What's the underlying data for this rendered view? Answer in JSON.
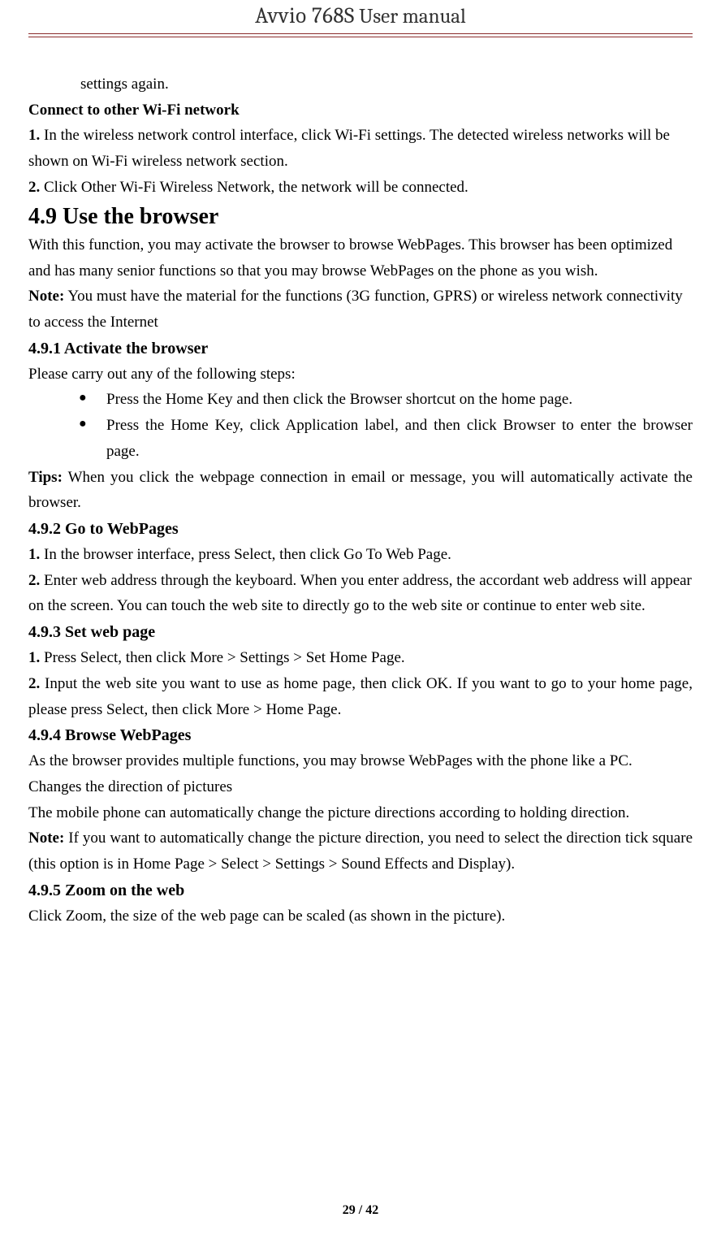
{
  "header": {
    "title_model": "Avvio 768S",
    "title_suffix": " User manual"
  },
  "body": {
    "p_settings_again": "settings again.",
    "h_connect_other": "Connect to other Wi-Fi network",
    "step_c1_a": "1.",
    "step_c1_b": " In the wireless network control interface, click Wi-Fi settings. The detected wireless networks will be shown on Wi-Fi wireless network section.",
    "step_c2_a": "2.",
    "step_c2_b": " Click Other Wi-Fi Wireless Network, the network will be connected.",
    "h49": "4.9 Use the browser",
    "p49_intro": "With this function, you may activate the browser to browse WebPages. This browser has been optimized and has many senior functions so that you may browse WebPages on the phone as you wish.",
    "note_label": "Note:",
    "p49_note": " You must have the material for the functions (3G function, GPRS) or wireless network connectivity to access the Internet",
    "h491": "4.9.1 Activate the browser",
    "p491_intro": "Please carry out any of the following steps:",
    "bullet1": "Press the Home Key and then click the Browser shortcut on the home page.",
    "bullet2": "Press the Home Key, click Application label, and then click Browser to enter the browser page.",
    "tips_label": "Tips:",
    "p491_tips": " When you click the webpage connection in email or message, you will automatically activate the browser.",
    "h492": "4.9.2 Go to WebPages",
    "s492_1a": "1.",
    "s492_1b": " In the browser interface, press Select, then click Go To Web Page.",
    "s492_2a": "2.",
    "s492_2b": " Enter web address through the keyboard. When you enter address, the accordant web address will appear on the screen. You can touch the web site to directly go to the web site or continue to enter web site.",
    "h493": "4.9.3 Set web page",
    "s493_1a": "1.",
    "s493_1b": " Press Select, then click More > Settings > Set Home Page.",
    "s493_2a": "2.",
    "s493_2b": " Input the web site you want to use as home page, then click OK. If you want to go to your home page, please press Select, then click More > Home Page.",
    "h494": "4.9.4 Browse WebPages",
    "p494_1": "As the browser provides multiple functions, you may browse WebPages with the phone like a PC.",
    "p494_2": "Changes the direction of pictures",
    "p494_3": "The mobile phone can automatically change the picture directions according to holding direction.",
    "p494_note": " If you want to automatically change the picture direction, you need to select the direction tick square (this option is in Home Page > Select > Settings > Sound Effects and Display).",
    "h495": "4.9.5 Zoom on the web",
    "p495": "Click Zoom, the size of the web page can be scaled (as shown in the picture)."
  },
  "footer": {
    "page_indicator": "29 / 42"
  }
}
